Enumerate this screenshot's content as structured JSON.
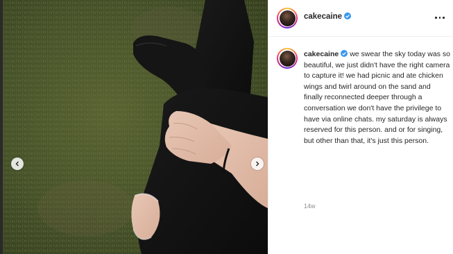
{
  "post": {
    "author": {
      "username": "cakecaine",
      "verified": true,
      "avatar": "profile-photo"
    },
    "caption": "we swear the sky today was so beautiful, we just didn't have the right camera to capture it! we had picnic and ate chicken wings and twirl around on the sand and finally reconnected deeper through a conversation we don't have the privilege to have via online chats. my saturday is always reserved for this person. and or for singing, but other than that, it's just this person.",
    "timestamp": "14w"
  },
  "icons": {
    "verified": "verified-badge-icon",
    "more": "more-options-icon",
    "prev": "chevron-left-icon",
    "next": "chevron-right-icon"
  },
  "colors": {
    "verified_blue": "#3897f0",
    "text": "#262626",
    "muted": "#8e8e8e",
    "border": "#efefef"
  }
}
